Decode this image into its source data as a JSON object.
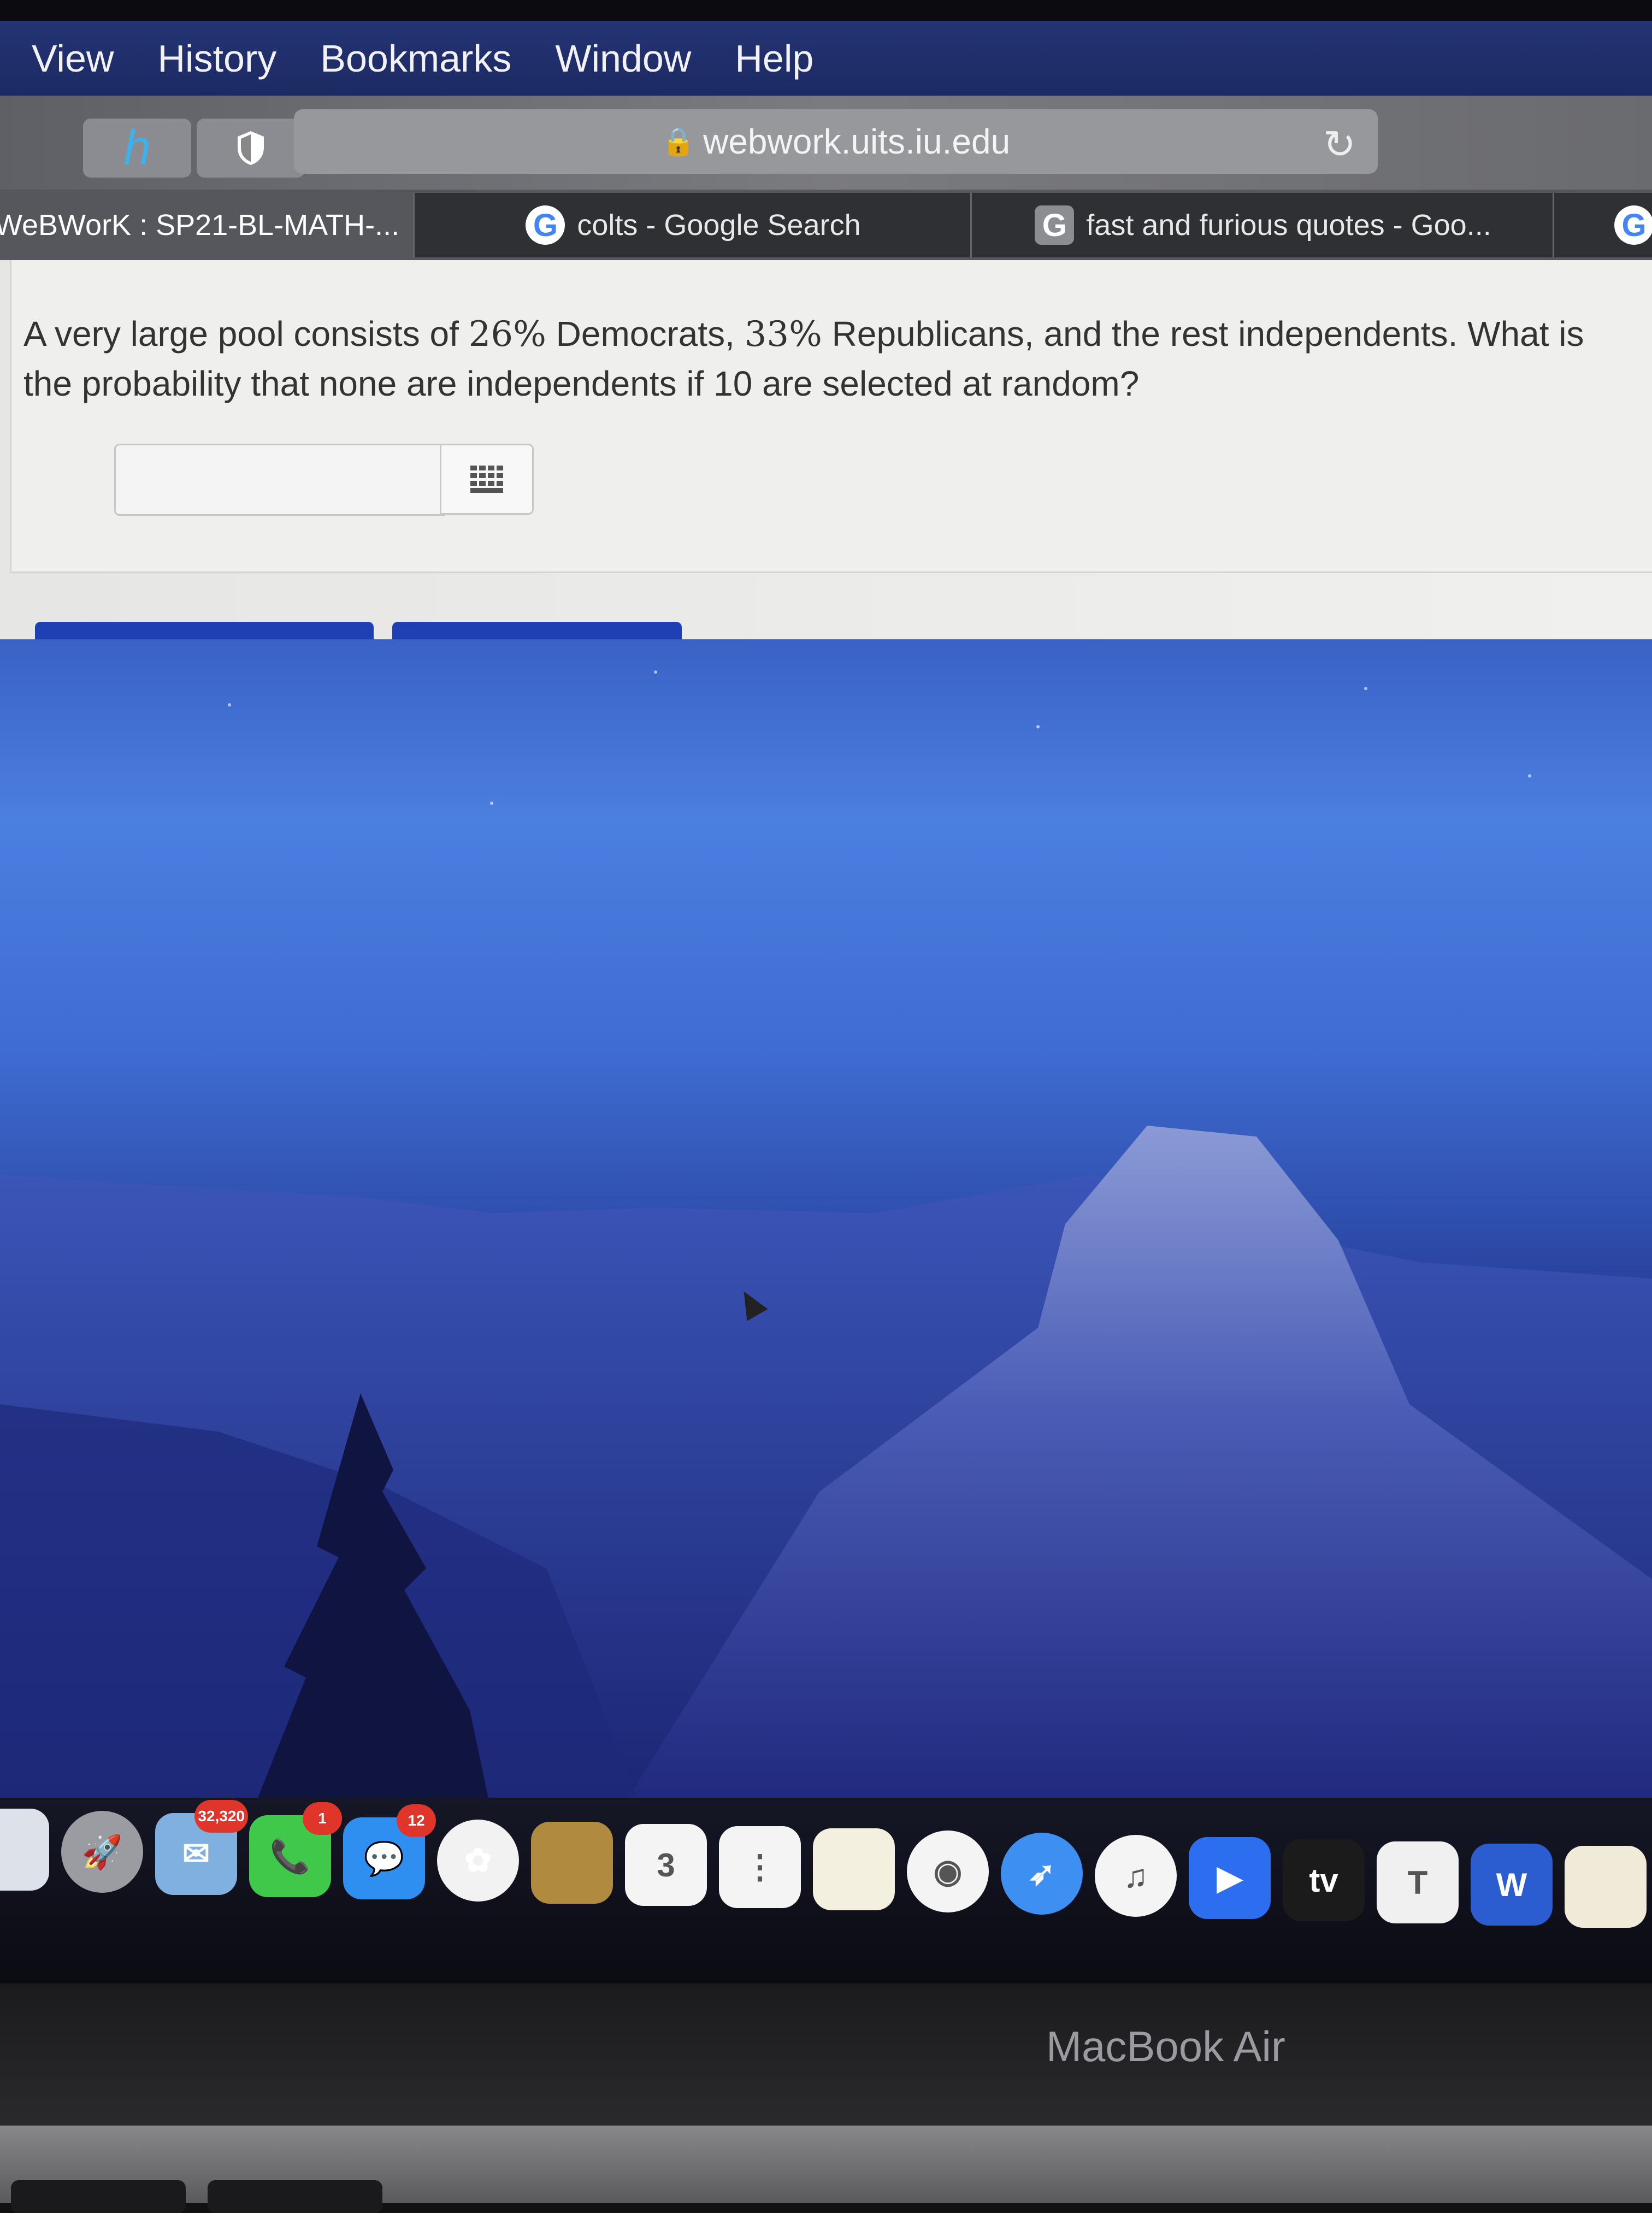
{
  "menubar": {
    "items": [
      "View",
      "History",
      "Bookmarks",
      "Window",
      "Help"
    ]
  },
  "toolbar": {
    "url": "webwork.uits.iu.edu",
    "extension_icons": [
      "honey-h-icon",
      "shield-icon"
    ]
  },
  "tabs": [
    {
      "label": "WeBWorK : SP21-BL-MATH-...",
      "active": true
    },
    {
      "label": "colts - Google Search",
      "icon": "G"
    },
    {
      "label": "fast and furious quotes - Goo...",
      "icon": "G"
    },
    {
      "label": "",
      "icon": "G"
    }
  ],
  "problem": {
    "q_part1": "A very large pool consists of ",
    "pct1": "26%",
    "q_part2": " Democrats, ",
    "pct2": "33%",
    "q_part3": " Republicans, and the rest independents. What is the probability that none are independents if 10 are selected at random?",
    "answer_value": "",
    "answer_placeholder": ""
  },
  "dock": {
    "items": [
      {
        "name": "finder",
        "color": "#dde2ea",
        "glyph": ""
      },
      {
        "name": "launchpad",
        "color": "#9a9ca2",
        "glyph": "🚀"
      },
      {
        "name": "mail-preview",
        "color": "#7fb0e0",
        "glyph": "✉",
        "badge": "32,320"
      },
      {
        "name": "facetime",
        "color": "#3fc84a",
        "glyph": "📞",
        "badge": "1"
      },
      {
        "name": "messages",
        "color": "#2e8ff0",
        "glyph": "💬",
        "badge": "12"
      },
      {
        "name": "photos",
        "color": "#f2f2f2",
        "glyph": "✿"
      },
      {
        "name": "contacts",
        "color": "#b08a3e",
        "glyph": ""
      },
      {
        "name": "calendar",
        "color": "#f4f4f4",
        "glyph": "3"
      },
      {
        "name": "reminders",
        "color": "#f4f4f4",
        "glyph": "⋮"
      },
      {
        "name": "notes",
        "color": "#f3f0e0",
        "glyph": ""
      },
      {
        "name": "chrome",
        "color": "#f4f4f4",
        "glyph": "◉"
      },
      {
        "name": "safari",
        "color": "#3d8ff2",
        "glyph": "➶"
      },
      {
        "name": "music",
        "color": "#f4f4f4",
        "glyph": "♫"
      },
      {
        "name": "zoom",
        "color": "#2d6ef0",
        "glyph": "▶"
      },
      {
        "name": "apple-tv",
        "color": "#1b1b1b",
        "glyph": "tv"
      },
      {
        "name": "keynote",
        "color": "#f0f0f0",
        "glyph": "T"
      },
      {
        "name": "word",
        "color": "#2b5cd0",
        "glyph": "W"
      },
      {
        "name": "app-partial",
        "color": "#f0ead8",
        "glyph": ""
      }
    ]
  },
  "laptop": {
    "brand": "MacBook Air"
  },
  "colors": {
    "menubar": "#1f2f6e",
    "webwork_button": "#1f3fb4",
    "desktop_sky": "#4b7fe0"
  }
}
